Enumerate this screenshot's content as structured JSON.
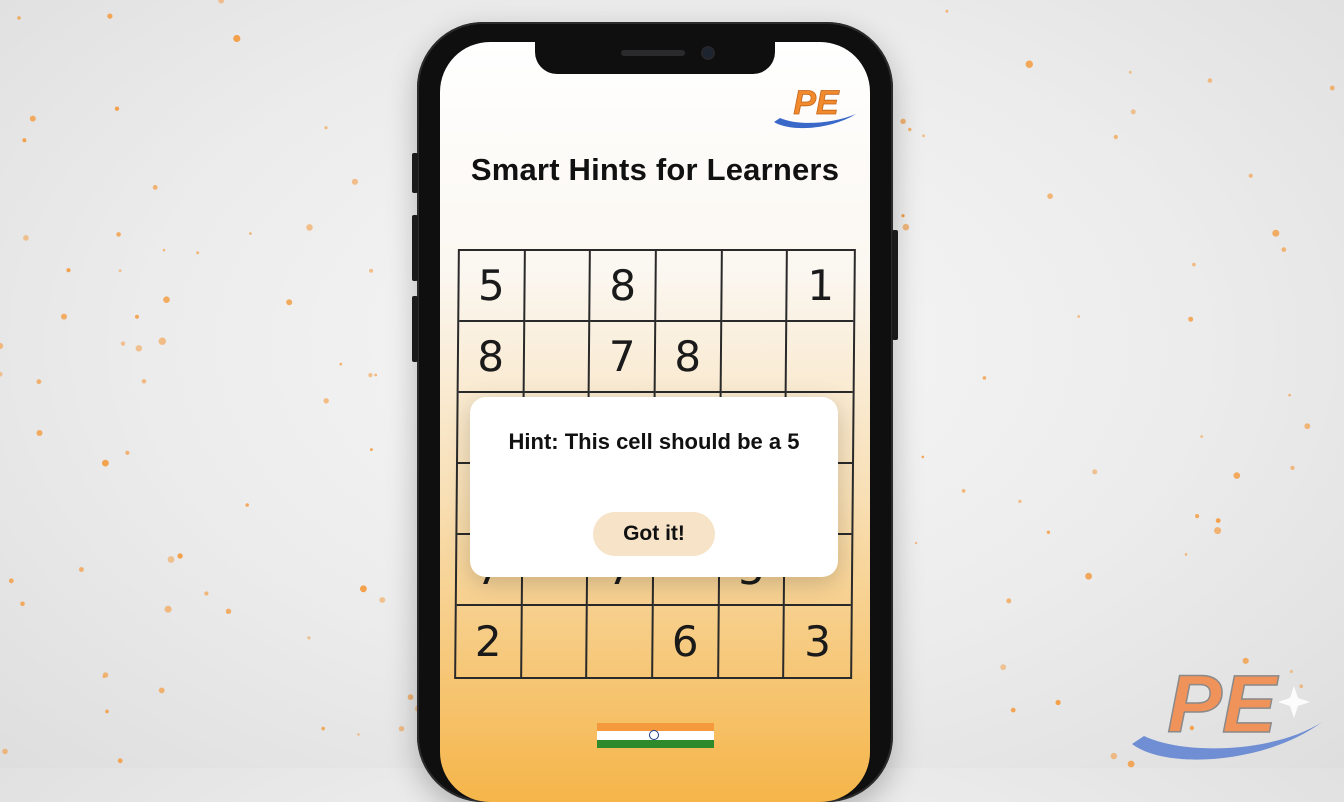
{
  "screen": {
    "title": "Smart Hints for Learners",
    "logo_text": "PE",
    "flag": "india-flag"
  },
  "puzzle": {
    "rows": [
      [
        "5",
        "",
        "8",
        "",
        "",
        "1"
      ],
      [
        "8",
        "",
        "7",
        "8",
        "",
        ""
      ],
      [
        "",
        "",
        "",
        "",
        "",
        ""
      ],
      [
        "",
        "",
        "",
        "",
        "",
        ""
      ],
      [
        "7",
        "",
        "7",
        "",
        "5",
        ""
      ],
      [
        "2",
        "",
        "",
        "6",
        "",
        "3"
      ]
    ]
  },
  "hint_dialog": {
    "message": "Hint: This cell should be a 5",
    "button_label": "Got it!"
  },
  "watermark": {
    "logo_text": "PE"
  },
  "colors": {
    "accent_orange": "#f08a2c",
    "logo_blue": "#3a68c8",
    "dialog_button_bg": "#f6e3c8",
    "dot_orange": "#f3a04a"
  }
}
